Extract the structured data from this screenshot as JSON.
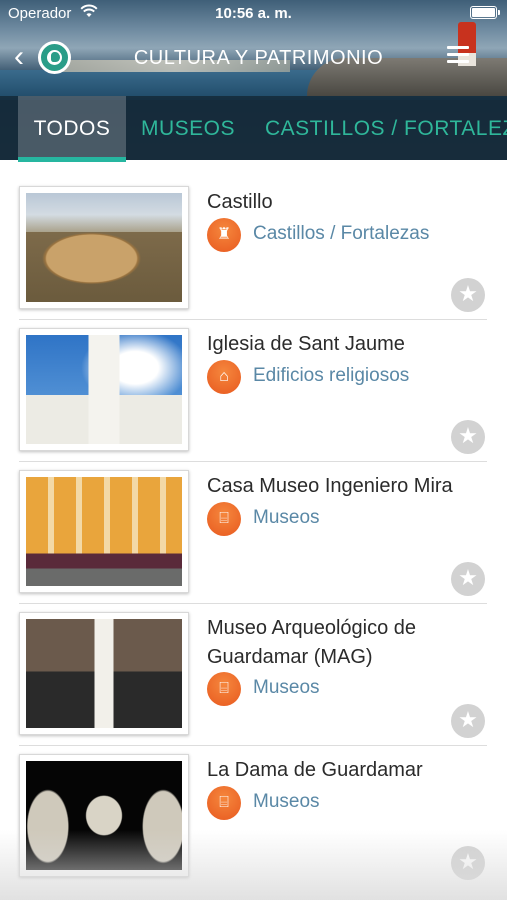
{
  "status_bar": {
    "carrier": "Operador",
    "time": "10:56 a. m."
  },
  "nav": {
    "back": "‹",
    "title": "CULTURA Y PATRIMONIO"
  },
  "tabs": [
    {
      "label": "TODOS",
      "active": true
    },
    {
      "label": "MUSEOS",
      "active": false
    },
    {
      "label": "CASTILLOS / FORTALEZAS",
      "active": false
    }
  ],
  "items": [
    {
      "name": "Castillo",
      "category": "Castillos / Fortalezas",
      "category_icon": "tower-icon",
      "image": "castle-photo",
      "favorite": false
    },
    {
      "name": "Iglesia de Sant Jaume",
      "category": "Edificios religiosos",
      "category_icon": "church-icon",
      "image": "church-photo",
      "favorite": false
    },
    {
      "name": "Casa Museo Ingeniero Mira",
      "category": "Museos",
      "category_icon": "museum-icon",
      "image": "museum-house-photo",
      "favorite": false
    },
    {
      "name": "Museo Arqueológico de Guardamar (MAG)",
      "category": "Museos",
      "category_icon": "museum-icon",
      "image": "mag-collage-photo",
      "favorite": false
    },
    {
      "name": "La Dama de Guardamar",
      "category": "Museos",
      "category_icon": "museum-icon",
      "image": "dama-sculpture-photo",
      "favorite": false
    }
  ],
  "colors": {
    "accent": "#26b6a0",
    "category_badge": "#e8591f",
    "category_text": "#5a88a6",
    "star_inactive": "#d2d2d2"
  }
}
